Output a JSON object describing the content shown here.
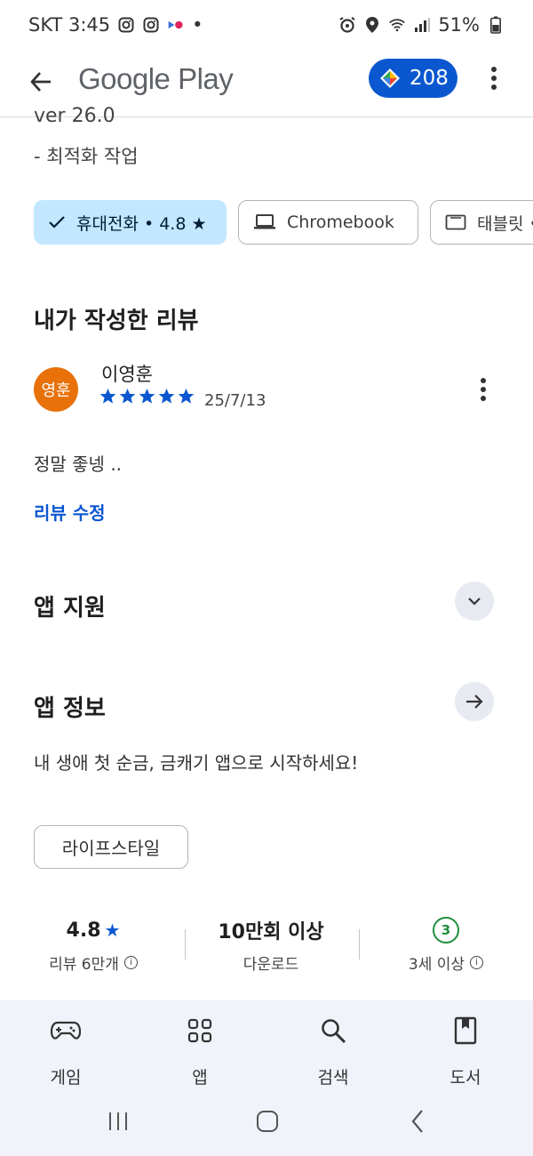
{
  "status": {
    "carrier_time": "SKT 3:45",
    "dot": "•",
    "battery": "51%"
  },
  "appbar": {
    "title": "Google Play",
    "points": "208"
  },
  "details": {
    "version_partial": "ver 26.0",
    "version_note": "- 최적화 작업"
  },
  "device_chips": [
    {
      "label": "휴대전화 • 4.8 ★",
      "selected": true
    },
    {
      "label": "Chromebook",
      "selected": false
    },
    {
      "label": "태블릿 •",
      "selected": false
    }
  ],
  "my_review": {
    "section_title": "내가 작성한 리뷰",
    "avatar_text": "영훈",
    "name": "이영훈",
    "rating": 5,
    "date": "25/7/13",
    "text": "정말 좋넹 ..",
    "edit_label": "리뷰 수정"
  },
  "app_support": {
    "title": "앱 지원"
  },
  "app_info": {
    "title": "앱 정보",
    "description": "내 생애 첫 순금, 금캐기 앱으로 시작하세요!",
    "category": "라이프스타일"
  },
  "stats": {
    "rating": "4.8",
    "rating_star": "★",
    "reviews": "리뷰 6만개",
    "downloads": "10만회 이상",
    "downloads_label": "다운로드",
    "age_badge": "3",
    "age_label": "3세 이상",
    "info_glyph": "i"
  },
  "bottom_nav": [
    {
      "label": "게임",
      "icon": "gamepad-icon"
    },
    {
      "label": "앱",
      "icon": "apps-grid-icon"
    },
    {
      "label": "검색",
      "icon": "search-icon"
    },
    {
      "label": "도서",
      "icon": "book-icon"
    }
  ],
  "colors": {
    "accent": "#0b57d0",
    "chip_selected": "#c2e7ff",
    "avatar": "#e8710a",
    "age_green": "#1e8e3e",
    "nav_bg": "#f0f3f9"
  }
}
